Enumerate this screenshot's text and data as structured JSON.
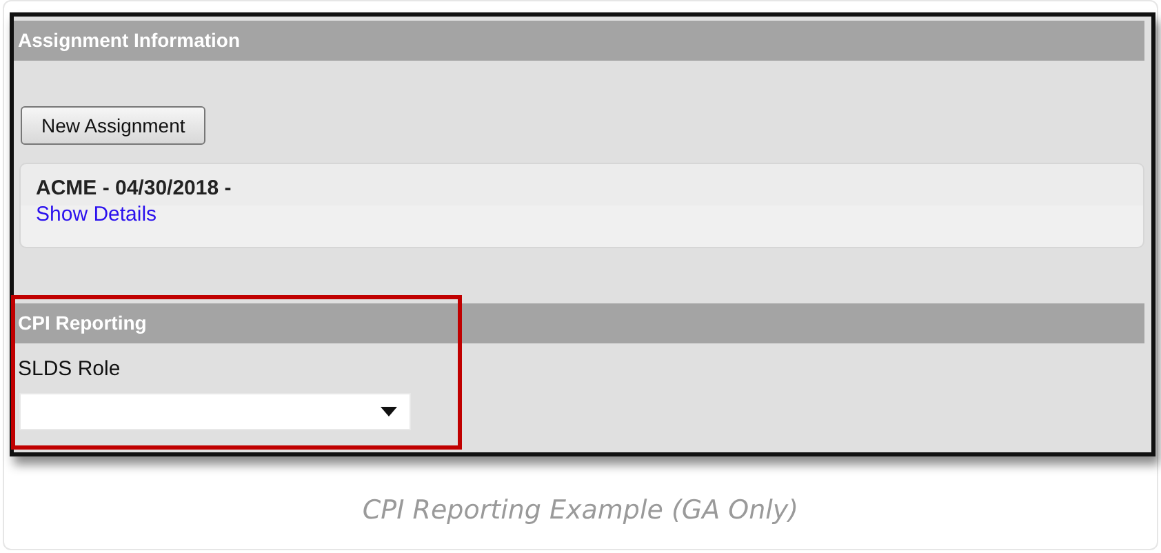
{
  "screenshot": {
    "sections": [
      {
        "kind": "assignments",
        "title": "Assignment Information",
        "highlighted": false,
        "button": "New Assignment",
        "assignments": [
          {
            "summary": "ACME - 04/30/2018 -",
            "link": "Show Details"
          }
        ]
      },
      {
        "kind": "field",
        "title": "CPI Reporting",
        "highlighted": true,
        "field_label": "SLDS Role"
      }
    ]
  },
  "caption": "CPI Reporting Example (GA Only)"
}
